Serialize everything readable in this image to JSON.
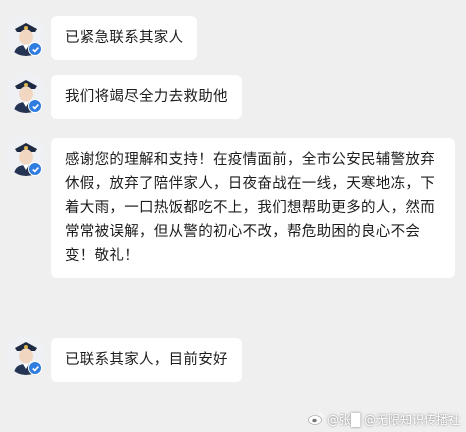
{
  "messages": [
    {
      "text": "已紧急联系其家人"
    },
    {
      "text": "我们将竭尽全力去救助他"
    },
    {
      "text": "感谢您的理解和支持！在疫情面前，全市公安民辅警放弃休假，放弃了陪伴家人，日夜奋战在一线，天寒地冻，下着大雨，一口热饭都吃不上，我们想帮助更多的人，然而常常被误解，但从警的初心不改，帮危助困的良心不会变！敬礼！"
    },
    {
      "text": "已联系其家人，目前安好"
    }
  ],
  "watermark": {
    "text": "@张█ @无限知识传播社"
  },
  "colors": {
    "background": "#efefef",
    "bubble": "#ffffff",
    "verified_badge": "#2f7de1"
  },
  "icons": {
    "avatar": "police-officer-avatar-icon",
    "badge": "verified-badge-icon",
    "watermark": "weibo-logo-icon"
  }
}
